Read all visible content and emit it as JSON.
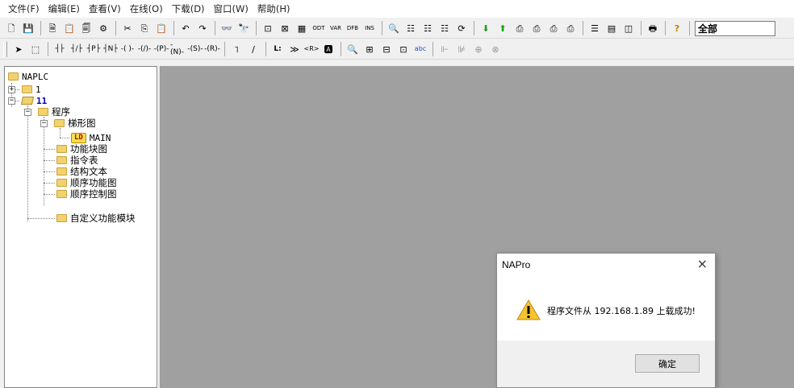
{
  "menu": [
    "文件(F)",
    "编辑(E)",
    "查看(V)",
    "在线(O)",
    "下载(D)",
    "窗口(W)",
    "帮助(H)"
  ],
  "toolbar1": {
    "icons": [
      "🗋",
      "💾",
      "🗎",
      "📋",
      "🗐",
      "⚙",
      "✂",
      "⎘",
      "📋",
      "↶",
      "↷",
      "👓",
      "🔭",
      "⊡",
      "⊠",
      "▦",
      "ODT",
      "VAR",
      "DFB",
      "INS",
      "🔍",
      "☷",
      "☷",
      "☷",
      "⟳",
      "⬇",
      "⬆",
      "⎙",
      "⎙",
      "⎙",
      "⎙",
      "☰",
      "▤",
      "◫",
      "🖶",
      "?"
    ],
    "combo_value": "全部"
  },
  "toolbar2": {
    "icons": [
      "➤",
      "⬚",
      "┤├",
      "┤/├",
      "┤P├",
      "┤N├",
      "-( )-",
      "-(/)-",
      "-(P)-",
      "-(N)-",
      "-(S)-",
      "-(R)-",
      "˥",
      "∕",
      "L:",
      "≫",
      "<R>",
      "🅰",
      "🔍",
      "⊞",
      "⊟",
      "⊡",
      "abc",
      "⊩",
      "⊯",
      "⊕",
      "⊗"
    ]
  },
  "tree": {
    "root": "NAPLC",
    "items": [
      {
        "label": "1"
      },
      {
        "label": "11"
      },
      {
        "label": "程序"
      },
      {
        "label": "梯形图"
      },
      {
        "label": "MAIN",
        "badge": "LD"
      },
      {
        "label": "功能块图"
      },
      {
        "label": "指令表"
      },
      {
        "label": "结构文本"
      },
      {
        "label": "顺序功能图"
      },
      {
        "label": "顺序控制图"
      },
      {
        "label": "自定义功能模块"
      }
    ]
  },
  "dialog": {
    "title": "NAPro",
    "close": "×",
    "message": "程序文件从 192.168.1.89 上载成功!",
    "ok_label": "确定"
  },
  "colors": {
    "workspace": "#a0a0a0",
    "folder": "#f2d26c",
    "highlight_text": "#0000c0"
  }
}
